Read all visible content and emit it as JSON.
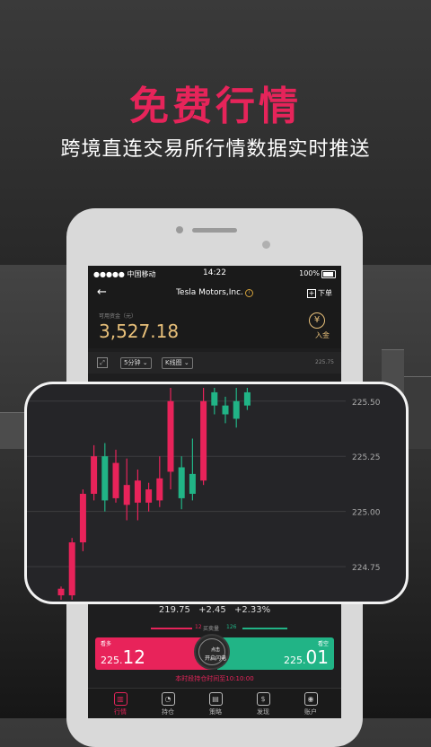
{
  "headline": "免费行情",
  "subline": "跨境直连交易所行情数据实时推送",
  "status": {
    "carrier": "●●●●● 中国移动",
    "time": "14:22",
    "battery": "100%"
  },
  "nav": {
    "title": "Tesla Motors,Inc.",
    "order_label": "下单"
  },
  "funds": {
    "label": "可用资金（元）",
    "amount": "3,527.18",
    "deposit_label": "入金",
    "currency_symbol": "¥"
  },
  "chart_tools": {
    "interval": "5分钟",
    "chart_kind": "K线图"
  },
  "quote": {
    "price": "219.75",
    "change": "+2.45",
    "change_pct": "+2.33%"
  },
  "volume": {
    "buy": "12",
    "label": "买卖量",
    "sell": "126"
  },
  "trade": {
    "long_label": "看多",
    "long_price_main": "225.",
    "long_price_frac": "12",
    "short_label": "看空",
    "short_price_main": "225.",
    "short_price_frac": "01",
    "flash_line1": "点击",
    "flash_line2": "开启闪电"
  },
  "hours": "本时段持仓时间至10:10:00",
  "tabs": [
    {
      "label": "行情",
      "icon": "chart-icon",
      "active": true
    },
    {
      "label": "持仓",
      "icon": "pie-icon",
      "active": false
    },
    {
      "label": "策略",
      "icon": "strategy-icon",
      "active": false
    },
    {
      "label": "发现",
      "icon": "discover-icon",
      "active": false
    },
    {
      "label": "账户",
      "icon": "account-icon",
      "active": false
    }
  ],
  "colors": {
    "accent": "#e6245a",
    "up": "#e8235a",
    "down": "#21b486",
    "gold": "#e8c07a"
  },
  "chart_data": {
    "type": "candlestick",
    "title": "",
    "xlabel": "",
    "ylabel": "",
    "y_ticks": [
      "225.75",
      "225.50",
      "225.25",
      "225.00",
      "224.75"
    ],
    "ylim": [
      224.6,
      225.56
    ],
    "candles": [
      {
        "open": 224.65,
        "close": 224.62,
        "high": 224.66,
        "low": 224.6,
        "dir": "up"
      },
      {
        "open": 224.62,
        "close": 224.86,
        "high": 224.88,
        "low": 224.6,
        "dir": "up"
      },
      {
        "open": 224.86,
        "close": 225.08,
        "high": 225.1,
        "low": 224.82,
        "dir": "up"
      },
      {
        "open": 225.08,
        "close": 225.25,
        "high": 225.3,
        "low": 225.05,
        "dir": "up"
      },
      {
        "open": 225.25,
        "close": 225.05,
        "high": 225.31,
        "low": 225.0,
        "dir": "down"
      },
      {
        "open": 225.06,
        "close": 225.22,
        "high": 225.28,
        "low": 225.04,
        "dir": "up"
      },
      {
        "open": 225.12,
        "close": 225.03,
        "high": 225.24,
        "low": 224.96,
        "dir": "up"
      },
      {
        "open": 225.04,
        "close": 225.14,
        "high": 225.19,
        "low": 224.96,
        "dir": "up"
      },
      {
        "open": 225.1,
        "close": 225.04,
        "high": 225.13,
        "low": 225.0,
        "dir": "up"
      },
      {
        "open": 225.05,
        "close": 225.15,
        "high": 225.25,
        "low": 225.02,
        "dir": "up"
      },
      {
        "open": 225.18,
        "close": 225.5,
        "high": 225.56,
        "low": 225.1,
        "dir": "up"
      },
      {
        "open": 225.2,
        "close": 225.06,
        "high": 225.25,
        "low": 225.01,
        "dir": "down"
      },
      {
        "open": 225.08,
        "close": 225.17,
        "high": 225.33,
        "low": 225.05,
        "dir": "down"
      },
      {
        "open": 225.14,
        "close": 225.5,
        "high": 225.56,
        "low": 225.12,
        "dir": "up"
      },
      {
        "open": 225.48,
        "close": 225.54,
        "high": 225.56,
        "low": 225.44,
        "dir": "down"
      },
      {
        "open": 225.44,
        "close": 225.48,
        "high": 225.52,
        "low": 225.4,
        "dir": "down"
      },
      {
        "open": 225.42,
        "close": 225.5,
        "high": 225.56,
        "low": 225.38,
        "dir": "down"
      },
      {
        "open": 225.48,
        "close": 225.54,
        "high": 225.56,
        "low": 225.46,
        "dir": "down"
      }
    ]
  }
}
